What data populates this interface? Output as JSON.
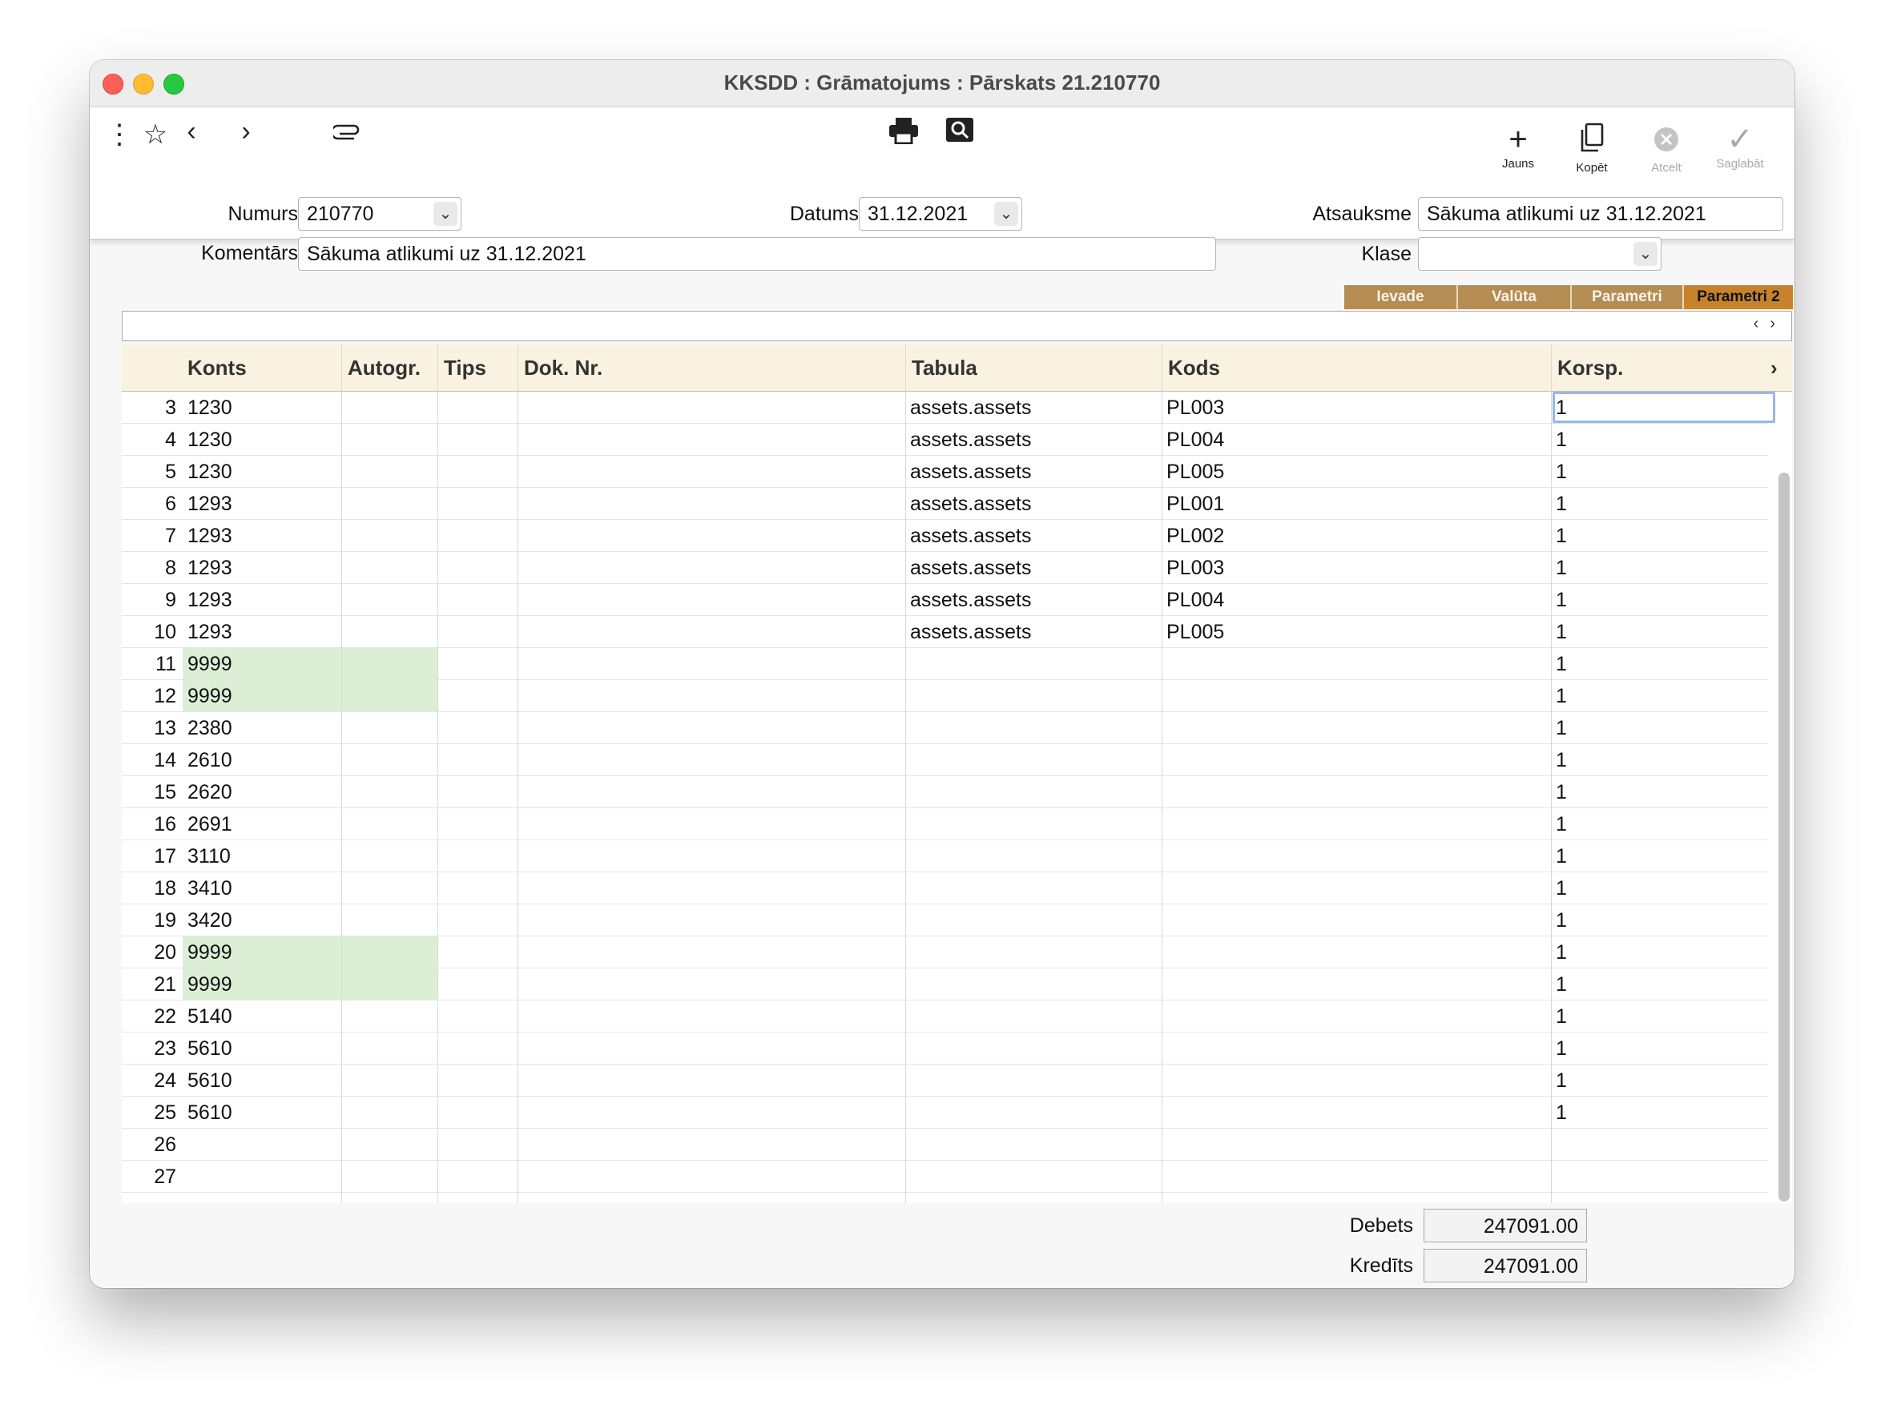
{
  "window": {
    "title": "KKSDD : Grāmatojums : Pārskats 21.210770"
  },
  "toolbar": {
    "buttons": [
      {
        "label": "Jauns",
        "icon": "plus-icon"
      },
      {
        "label": "Kopēt",
        "icon": "copy-icon"
      },
      {
        "label": "Atcelt",
        "icon": "cancel-icon"
      },
      {
        "label": "Saglabāt",
        "icon": "check-icon"
      }
    ]
  },
  "form": {
    "numurs_label": "Numurs",
    "numurs_value": "210770",
    "datums_label": "Datums",
    "datums_value": "31.12.2021",
    "atsauksme_label": "Atsauksme",
    "atsauksme_value": "Sākuma atlikumi uz 31.12.2021",
    "komentars_label": "Komentārs",
    "komentars_value": "Sākuma atlikumi uz 31.12.2021",
    "klase_label": "Klase",
    "klase_value": ""
  },
  "tabs": [
    {
      "label": "Ievade",
      "active": false
    },
    {
      "label": "Valūta",
      "active": false
    },
    {
      "label": "Parametri",
      "active": false
    },
    {
      "label": "Parametri 2",
      "active": true
    }
  ],
  "table": {
    "columns": [
      "Konts",
      "Autogr.",
      "Tips",
      "Dok. Nr.",
      "Tabula",
      "Kods",
      "Korsp."
    ],
    "rows": [
      {
        "n": "3",
        "konts": "1230",
        "tabula": "assets.assets",
        "kods": "PL003",
        "korsp": "1",
        "green": false
      },
      {
        "n": "4",
        "konts": "1230",
        "tabula": "assets.assets",
        "kods": "PL004",
        "korsp": "1",
        "green": false
      },
      {
        "n": "5",
        "konts": "1230",
        "tabula": "assets.assets",
        "kods": "PL005",
        "korsp": "1",
        "green": false
      },
      {
        "n": "6",
        "konts": "1293",
        "tabula": "assets.assets",
        "kods": "PL001",
        "korsp": "1",
        "green": false
      },
      {
        "n": "7",
        "konts": "1293",
        "tabula": "assets.assets",
        "kods": "PL002",
        "korsp": "1",
        "green": false
      },
      {
        "n": "8",
        "konts": "1293",
        "tabula": "assets.assets",
        "kods": "PL003",
        "korsp": "1",
        "green": false
      },
      {
        "n": "9",
        "konts": "1293",
        "tabula": "assets.assets",
        "kods": "PL004",
        "korsp": "1",
        "green": false
      },
      {
        "n": "10",
        "konts": "1293",
        "tabula": "assets.assets",
        "kods": "PL005",
        "korsp": "1",
        "green": false
      },
      {
        "n": "11",
        "konts": "9999",
        "tabula": "",
        "kods": "",
        "korsp": "1",
        "green": true
      },
      {
        "n": "12",
        "konts": "9999",
        "tabula": "",
        "kods": "",
        "korsp": "1",
        "green": true
      },
      {
        "n": "13",
        "konts": "2380",
        "tabula": "",
        "kods": "",
        "korsp": "1",
        "green": false
      },
      {
        "n": "14",
        "konts": "2610",
        "tabula": "",
        "kods": "",
        "korsp": "1",
        "green": false
      },
      {
        "n": "15",
        "konts": "2620",
        "tabula": "",
        "kods": "",
        "korsp": "1",
        "green": false
      },
      {
        "n": "16",
        "konts": "2691",
        "tabula": "",
        "kods": "",
        "korsp": "1",
        "green": false
      },
      {
        "n": "17",
        "konts": "3110",
        "tabula": "",
        "kods": "",
        "korsp": "1",
        "green": false
      },
      {
        "n": "18",
        "konts": "3410",
        "tabula": "",
        "kods": "",
        "korsp": "1",
        "green": false
      },
      {
        "n": "19",
        "konts": "3420",
        "tabula": "",
        "kods": "",
        "korsp": "1",
        "green": false
      },
      {
        "n": "20",
        "konts": "9999",
        "tabula": "",
        "kods": "",
        "korsp": "1",
        "green": true
      },
      {
        "n": "21",
        "konts": "9999",
        "tabula": "",
        "kods": "",
        "korsp": "1",
        "green": true
      },
      {
        "n": "22",
        "konts": "5140",
        "tabula": "",
        "kods": "",
        "korsp": "1",
        "green": false
      },
      {
        "n": "23",
        "konts": "5610",
        "tabula": "",
        "kods": "",
        "korsp": "1",
        "green": false
      },
      {
        "n": "24",
        "konts": "5610",
        "tabula": "",
        "kods": "",
        "korsp": "1",
        "green": false
      },
      {
        "n": "25",
        "konts": "5610",
        "tabula": "",
        "kods": "",
        "korsp": "1",
        "green": false
      },
      {
        "n": "26",
        "konts": "",
        "tabula": "",
        "kods": "",
        "korsp": "",
        "green": false
      },
      {
        "n": "27",
        "konts": "",
        "tabula": "",
        "kods": "",
        "korsp": "",
        "green": false
      }
    ]
  },
  "totals": {
    "debets_label": "Debets",
    "debets_value": "247091.00",
    "kredits_label": "Kredīts",
    "kredits_value": "247091.00"
  }
}
